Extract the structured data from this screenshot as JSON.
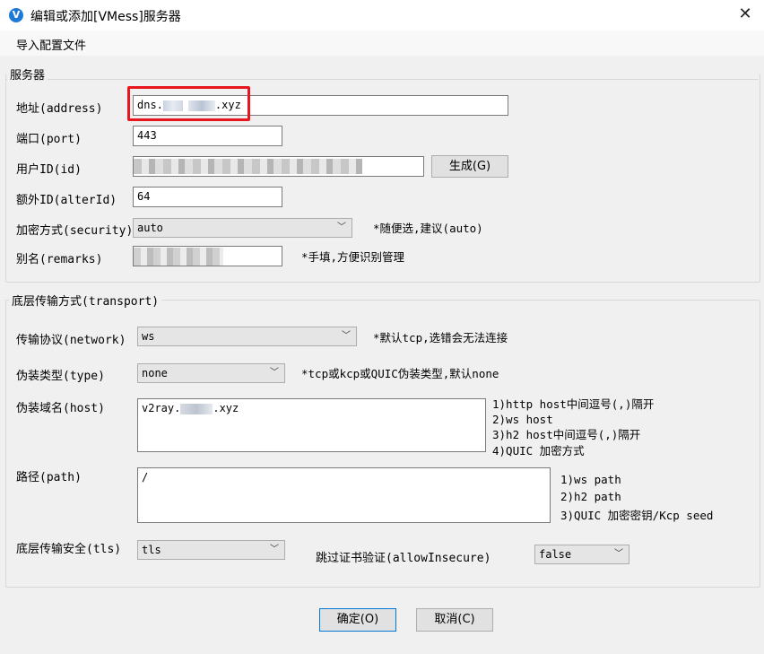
{
  "window": {
    "title": "编辑或添加[VMess]服务器",
    "close": "✕",
    "app_icon": "V"
  },
  "menu": {
    "import_config": "导入配置文件"
  },
  "server": {
    "legend": "服务器",
    "address_label": "地址(address)",
    "address_value": "dns.",
    "address_suffix": ".xyz",
    "port_label": "端口(port)",
    "port_value": "443",
    "userid_label": "用户ID(id)",
    "generate_button": "生成(G)",
    "alterid_label": "额外ID(alterId)",
    "alterid_value": "64",
    "security_label": "加密方式(security)",
    "security_value": "auto",
    "security_hint": "*随便选,建议(auto)",
    "remarks_label": "别名(remarks)",
    "remarks_hint": "*手填,方便识别管理"
  },
  "transport": {
    "legend": "底层传输方式(transport)",
    "network_label": "传输协议(network)",
    "network_value": "ws",
    "network_hint": "*默认tcp,选错会无法连接",
    "type_label": "伪装类型(type)",
    "type_value": "none",
    "type_hint": "*tcp或kcp或QUIC伪装类型,默认none",
    "host_label": "伪装域名(host)",
    "host_value_prefix": "v2ray.",
    "host_value_suffix": ".xyz",
    "host_hints": [
      "1)http host中间逗号(,)隔开",
      "2)ws host",
      "3)h2 host中间逗号(,)隔开",
      "4)QUIC 加密方式"
    ],
    "path_label": "路径(path)",
    "path_value": "/",
    "path_hints": [
      "1)ws path",
      "2)h2 path",
      "3)QUIC 加密密钥/Kcp seed"
    ],
    "tls_label": "底层传输安全(tls)",
    "tls_value": "tls",
    "allow_insecure_label": "跳过证书验证(allowInsecure)",
    "allow_insecure_value": "false"
  },
  "buttons": {
    "ok": "确定(O)",
    "cancel": "取消(C)"
  },
  "colors": {
    "highlight": "#e8141e",
    "accent": "#1e7ad6"
  }
}
